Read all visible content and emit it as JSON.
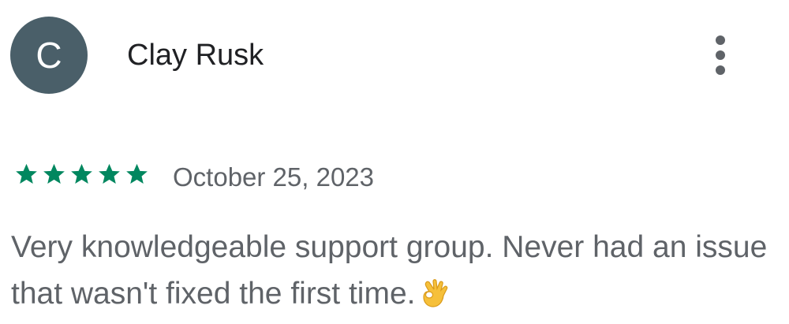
{
  "review": {
    "avatar_initial": "C",
    "author_name": "Clay Rusk",
    "rating": 5,
    "rating_max": 5,
    "date": "October 25, 2023",
    "text": "Very knowledgeable support group. Never had an issue that wasn't fixed the first time.",
    "emoji_icon": "ok-hand-icon"
  },
  "colors": {
    "avatar_bg": "#4a5f69",
    "star": "#01875f",
    "author_text": "#202124",
    "secondary_text": "#5f6368"
  }
}
